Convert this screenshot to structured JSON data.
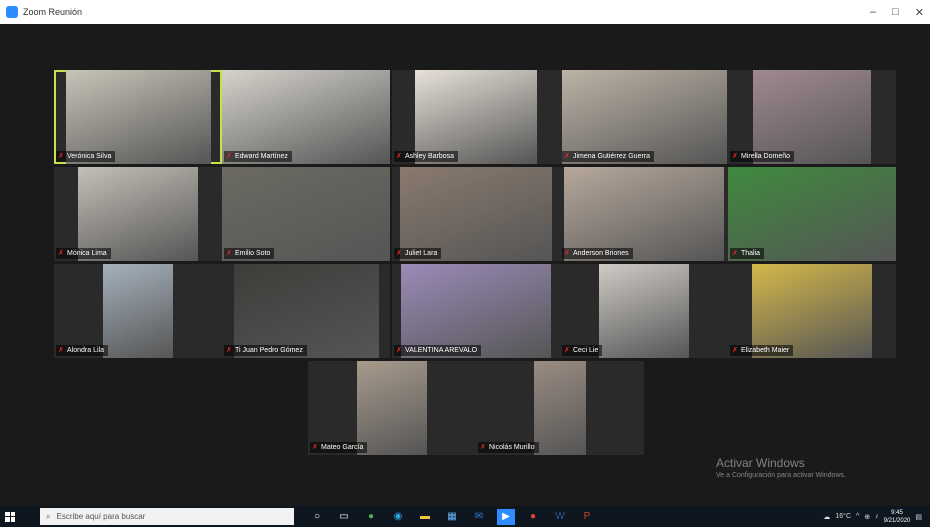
{
  "window": {
    "title": "Zoom Reunión",
    "minimize": "–",
    "maximize": "□",
    "close": "✕"
  },
  "participants": [
    {
      "name": "Verónica Silva",
      "bg": "#c9c4b8",
      "active": true
    },
    {
      "name": "Edward Martínez",
      "bg": "#d6d3cc"
    },
    {
      "name": "Ashley Barbosa",
      "bg": "#e7e1d8"
    },
    {
      "name": "Jimena Gutiérrez Guerra",
      "bg": "#bdb3a6"
    },
    {
      "name": "Mirella Domeño",
      "bg": "#a0898f"
    },
    {
      "name": "Mónica Lima",
      "bg": "#c4bfb7"
    },
    {
      "name": "Emilio Soto",
      "bg": "#6b6a62"
    },
    {
      "name": "Juliet Lara",
      "bg": "#8a7a6e"
    },
    {
      "name": "Anderson Briones",
      "bg": "#b7a89c"
    },
    {
      "name": "Thalia",
      "bg": "#3f8a3e"
    },
    {
      "name": "Alondra Lila",
      "bg": "#a5b1bc"
    },
    {
      "name": "Ti Juan Pedro Gómez",
      "bg": "#3f3d3a"
    },
    {
      "name": "VALENTINA AREVALO",
      "bg": "#9b8bb8"
    },
    {
      "name": "Ceci Lie",
      "bg": "#cfcbc6"
    },
    {
      "name": "Elizabeth Maier",
      "bg": "#d4b84a"
    },
    {
      "name": "Mateo García",
      "bg": "#a89b8d"
    },
    {
      "name": "Nicolás Murillo",
      "bg": "#9a8c82"
    }
  ],
  "watermark": {
    "line1": "Activar Windows",
    "line2": "Ve a Configuración para activar Windows."
  },
  "taskbar": {
    "search_placeholder": "Escribe aquí para buscar",
    "temperature": "16°C",
    "time": "9:45",
    "date": "9/21/2020",
    "accent": "#2d8cff"
  }
}
